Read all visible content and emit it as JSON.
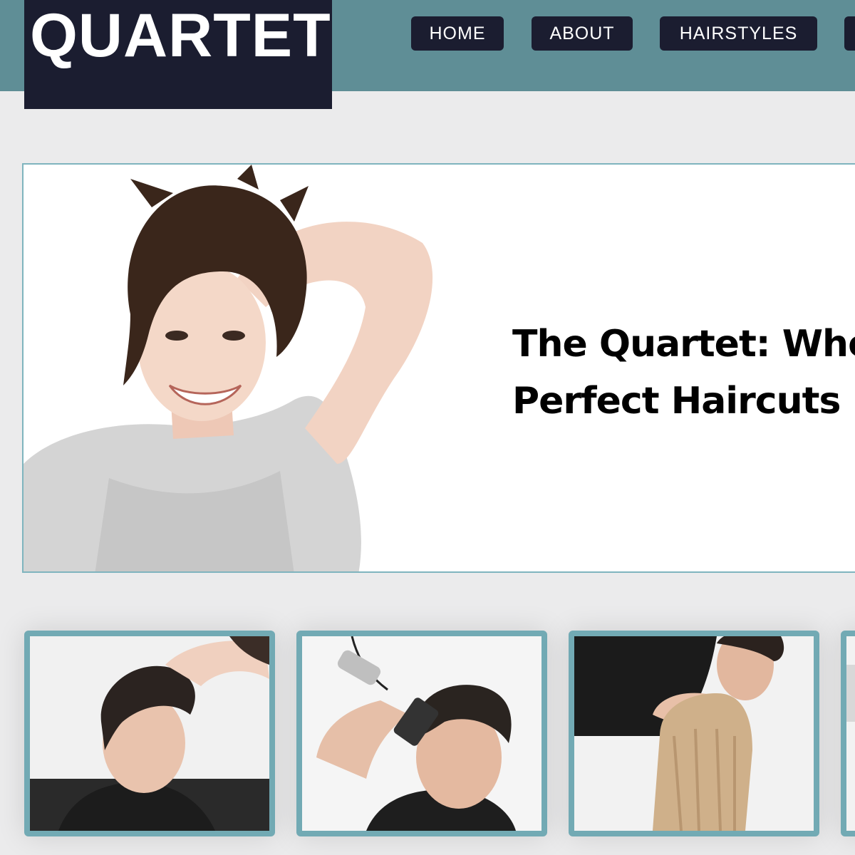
{
  "header": {
    "logo_text": "QUARTET",
    "nav": [
      {
        "label": "HOME"
      },
      {
        "label": "ABOUT"
      },
      {
        "label": "HAIRSTYLES"
      },
      {
        "label": ""
      }
    ]
  },
  "hero": {
    "headline_line1": "The Quartet: Whe",
    "headline_line2": "Perfect Haircuts I"
  },
  "colors": {
    "header_bar": "#5f8e96",
    "logo_bg": "#1b1d30",
    "nav_bg": "#1b1d30",
    "page_bg": "#ebebec",
    "frame_border": "#72aab4"
  }
}
